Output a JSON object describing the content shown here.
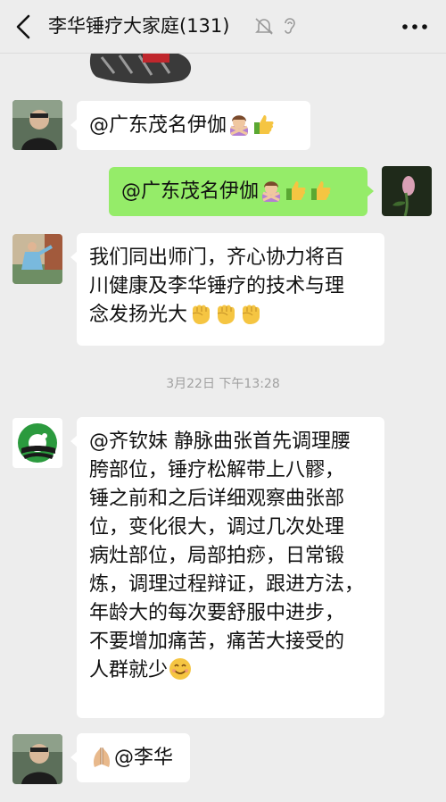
{
  "header": {
    "title": "李华锤疗大家庭(131)",
    "icons": [
      "back-arrow-icon",
      "mute-bell-icon",
      "ear-icon",
      "more-icon"
    ]
  },
  "messages": [
    {
      "sender": "left",
      "text": "@广东茂名伊伽",
      "emojis": [
        "woman-gesturing-no",
        "thumbs-up"
      ]
    },
    {
      "sender": "right",
      "text": "@广东茂名伊伽",
      "emojis": [
        "woman-gesturing-no",
        "thumbs-up",
        "thumbs-up"
      ]
    },
    {
      "sender": "left",
      "lines": [
        "我们同出师门，齐心协力将百",
        "川健康及李华锤疗的技术与理",
        "念发扬光大"
      ],
      "emojis": [
        "raised-fist",
        "raised-fist",
        "raised-fist"
      ]
    },
    {
      "timestamp": "3月22日 下午13:28"
    },
    {
      "sender": "left",
      "lines": [
        "@齐钦妹  静脉曲张首先调理腰",
        "胯部位，锤疗松解带上八髎，",
        "锤之前和之后详细观察曲张部",
        "位，变化很大，调过几次处理",
        "病灶部位，局部拍痧，日常锻",
        "炼，调理过程辩证，跟进方法，",
        "年龄大的每次要舒服中进步，",
        "不要增加痛苦，痛苦大接受的",
        "人群就少"
      ],
      "emojis": [
        "smiling-face"
      ]
    },
    {
      "sender": "left",
      "text": "@李华",
      "emojis": [
        "folded-hands"
      ]
    }
  ],
  "colors": {
    "background": "#ededed",
    "bubble_left": "#ffffff",
    "bubble_right": "#95ec69",
    "timestamp": "#a0a0a0"
  }
}
